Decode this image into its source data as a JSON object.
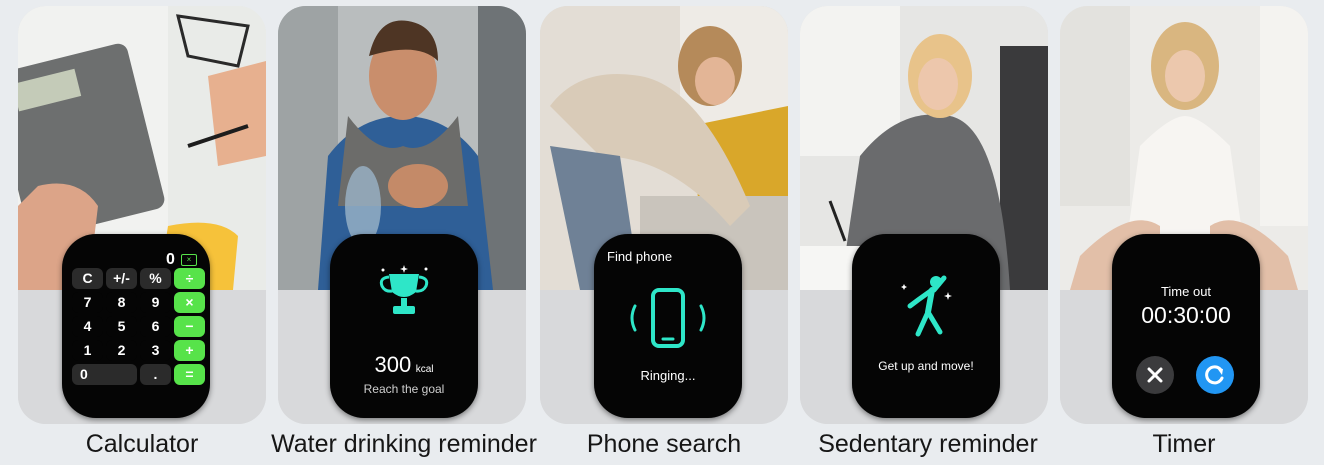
{
  "cards": [
    {
      "caption": "Calculator",
      "watch": {
        "display_value": "0",
        "keys": [
          [
            "C",
            "+/-",
            "%",
            "÷"
          ],
          [
            "7",
            "8",
            "9",
            "×"
          ],
          [
            "4",
            "5",
            "6",
            "−"
          ],
          [
            "1",
            "2",
            "3",
            "+"
          ],
          [
            "0",
            "",
            ".",
            "="
          ]
        ]
      }
    },
    {
      "caption": "Water drinking reminder",
      "watch": {
        "value": "300",
        "unit": "kcal",
        "subtitle": "Reach the goal"
      }
    },
    {
      "caption": "Phone search",
      "watch": {
        "title": "Find phone",
        "status": "Ringing..."
      }
    },
    {
      "caption": "Sedentary reminder",
      "watch": {
        "message": "Get up and move!"
      }
    },
    {
      "caption": "Timer",
      "watch": {
        "label": "Time out",
        "time": "00:30:00"
      }
    }
  ],
  "colors": {
    "accent_teal": "#2ee6c8",
    "accent_green": "#57e34a",
    "accent_blue": "#2196f3"
  }
}
